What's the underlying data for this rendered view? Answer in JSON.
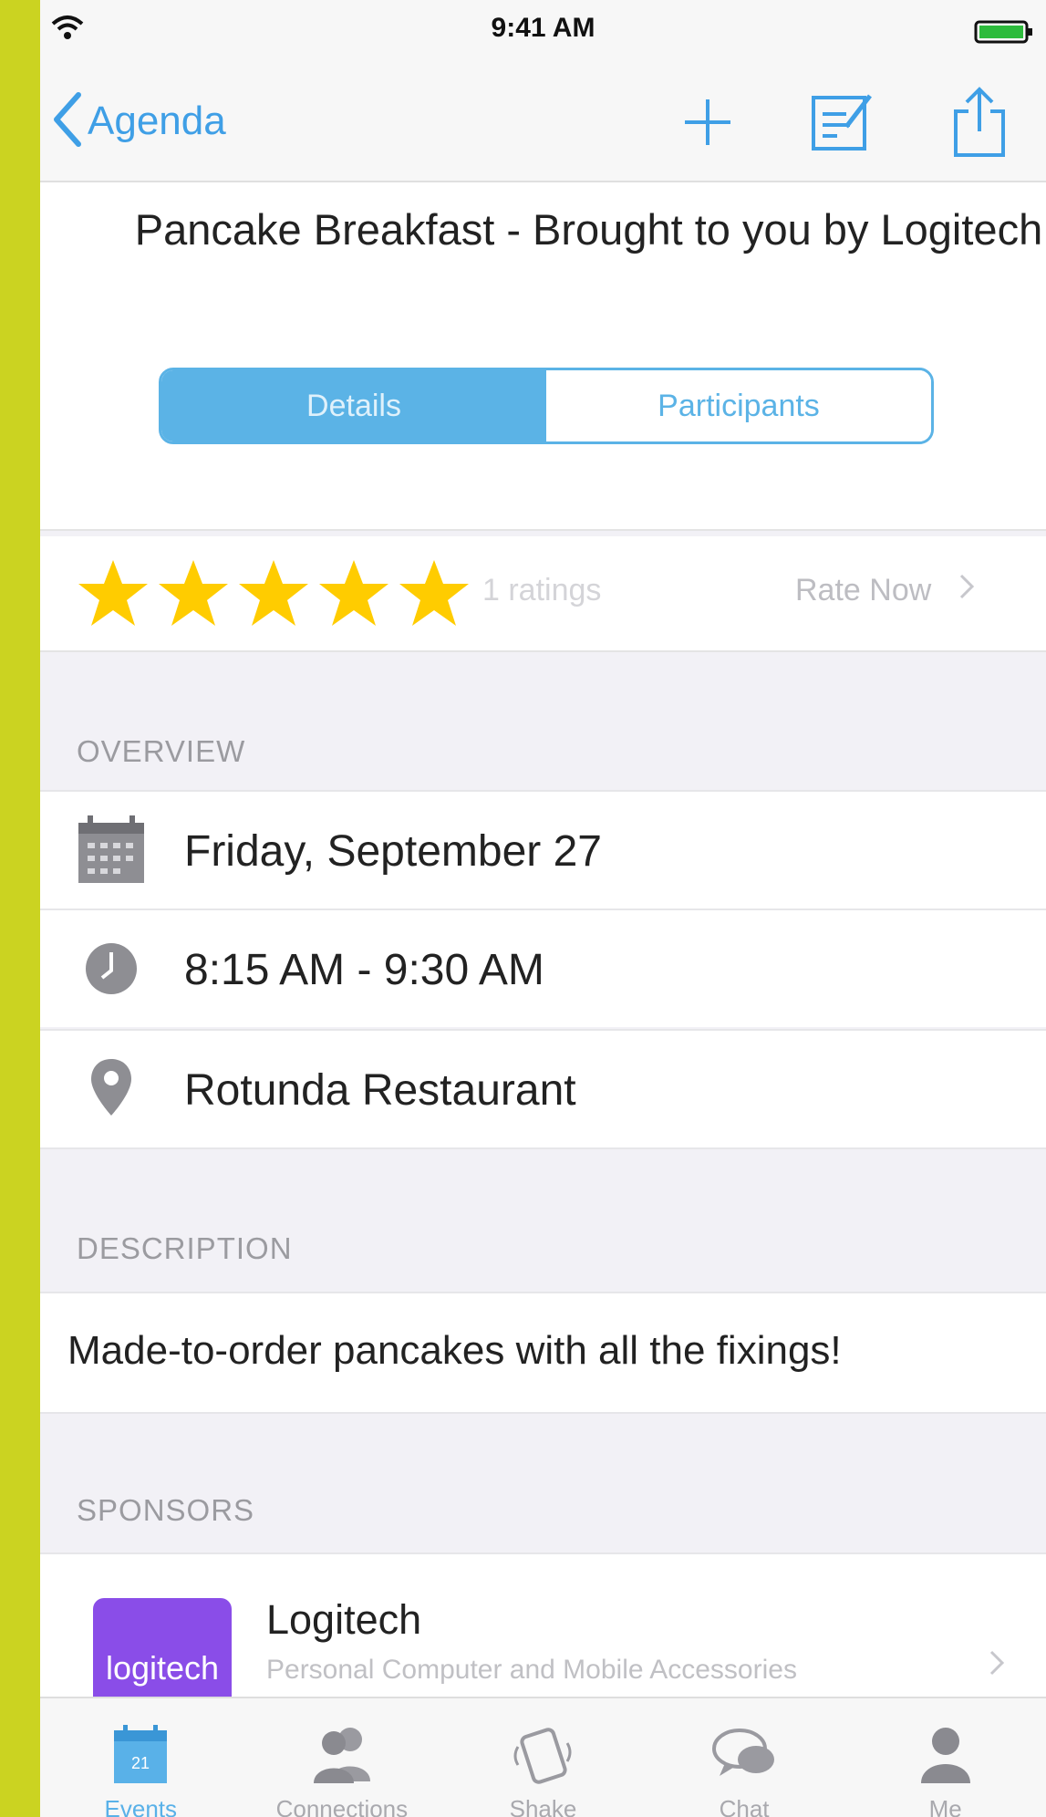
{
  "status_bar": {
    "time": "9:41 AM"
  },
  "nav": {
    "back_label": "Agenda",
    "accent_color": "#3f9fe6"
  },
  "event": {
    "title": "Pancake Breakfast - Brought to you by Logitech"
  },
  "segments": [
    {
      "label": "Details",
      "selected": true
    },
    {
      "label": "Participants",
      "selected": false
    }
  ],
  "rating": {
    "stars_filled": 5,
    "stars_total": 5,
    "count_label": "1 ratings",
    "rate_now_label": "Rate Now",
    "star_color": "#ffcc00"
  },
  "overview": {
    "header": "OVERVIEW",
    "date": "Friday, September 27",
    "time": "8:15 AM - 9:30 AM",
    "location": "Rotunda Restaurant"
  },
  "description": {
    "header": "DESCRIPTION",
    "text": "Made-to-order pancakes with all the fixings!"
  },
  "sponsors": {
    "header": "SPONSORS",
    "items": [
      {
        "name": "Logitech",
        "subtitle": "Personal Computer and Mobile Accessories",
        "logo_text": "logitech",
        "logo_color": "#8a4de8"
      }
    ]
  },
  "tabbar": {
    "items": [
      {
        "label": "Events",
        "icon": "calendar-icon",
        "active": true
      },
      {
        "label": "Connections",
        "icon": "people-icon",
        "active": false
      },
      {
        "label": "Shake",
        "icon": "shake-icon",
        "active": false
      },
      {
        "label": "Chat",
        "icon": "chat-icon",
        "active": false
      },
      {
        "label": "Me",
        "icon": "person-icon",
        "active": false
      }
    ],
    "calendar_day": "21"
  }
}
